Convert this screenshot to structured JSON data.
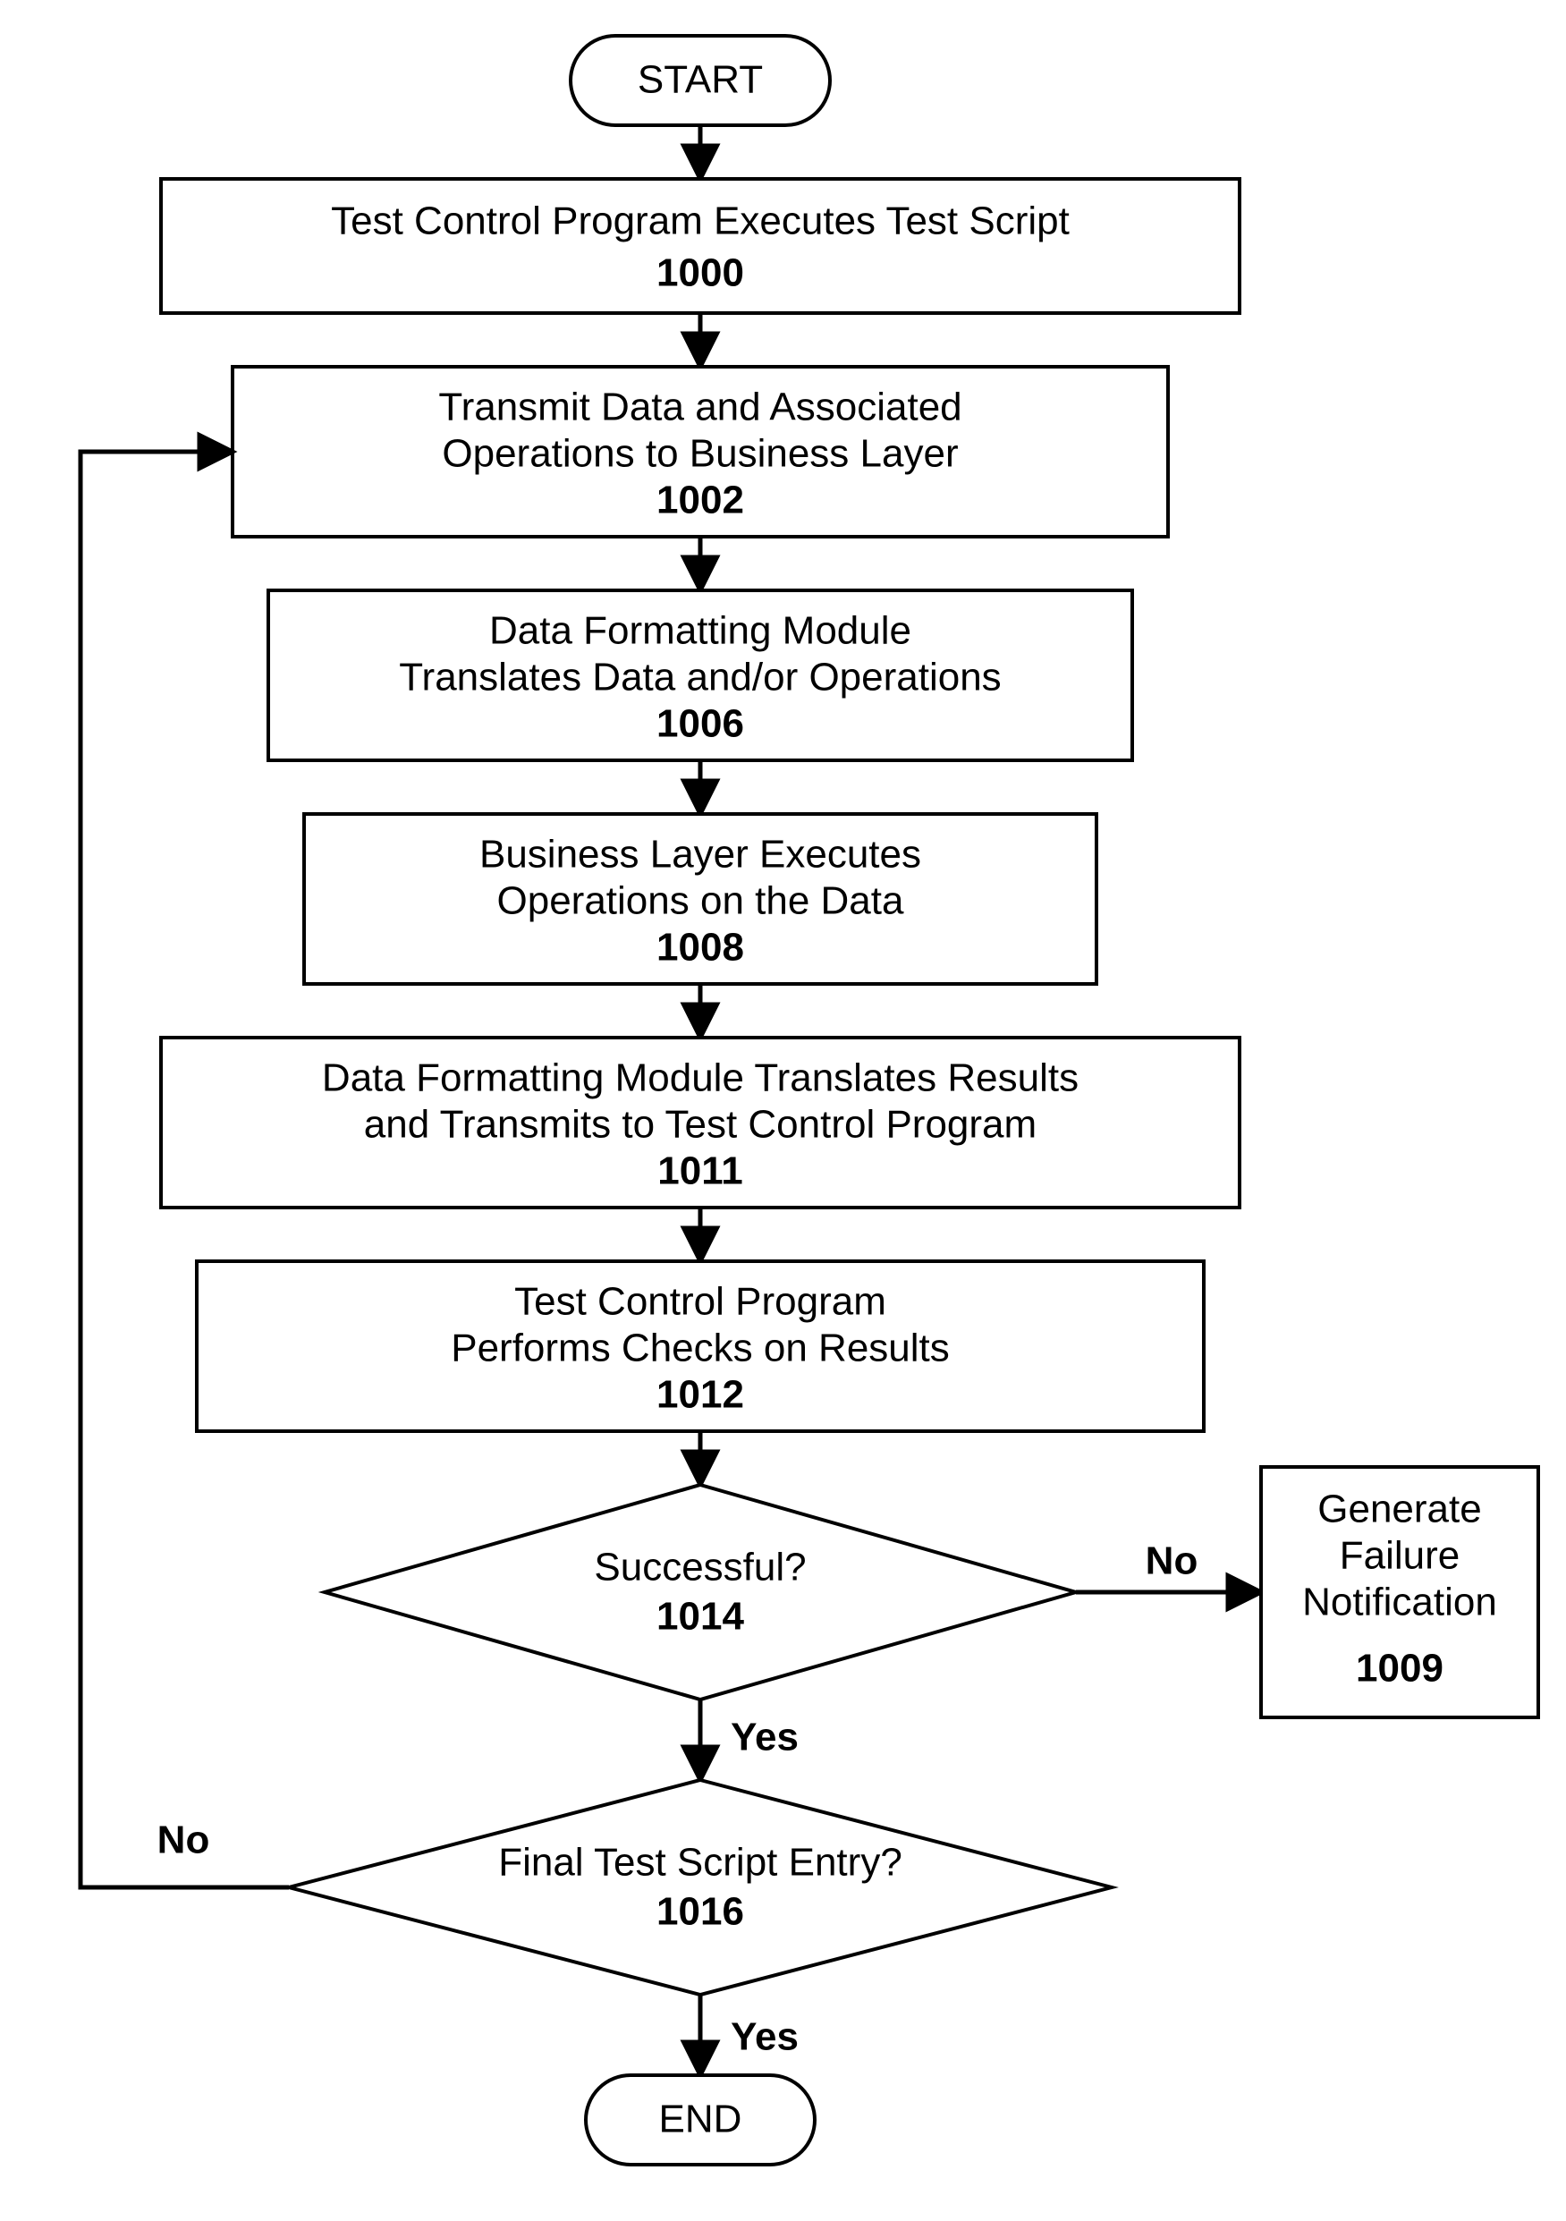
{
  "flow": {
    "start": "START",
    "end": "END",
    "b1000": {
      "t1": "Test Control Program Executes Test Script",
      "num": "1000"
    },
    "b1002": {
      "t1": "Transmit Data and Associated",
      "t2": "Operations to Business Layer",
      "num": "1002"
    },
    "b1006": {
      "t1": "Data Formatting Module",
      "t2": "Translates Data and/or Operations",
      "num": "1006"
    },
    "b1008": {
      "t1": "Business Layer Executes",
      "t2": "Operations on the Data",
      "num": "1008"
    },
    "b1011": {
      "t1": "Data Formatting Module Translates Results",
      "t2": "and Transmits to Test Control Program",
      "num": "1011"
    },
    "b1012": {
      "t1": "Test Control Program",
      "t2": "Performs Checks on Results",
      "num": "1012"
    },
    "d1014": {
      "t1": "Successful?",
      "num": "1014"
    },
    "d1016": {
      "t1": "Final Test Script Entry?",
      "num": "1016"
    },
    "b1009": {
      "t1": "Generate",
      "t2": "Failure",
      "t3": "Notification",
      "num": "1009"
    },
    "yes": "Yes",
    "no": "No"
  }
}
